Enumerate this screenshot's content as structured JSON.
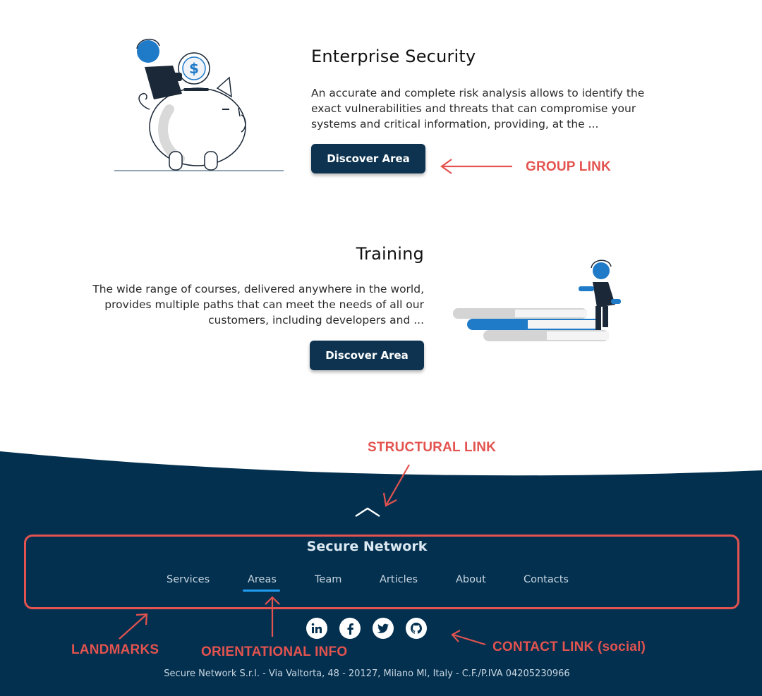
{
  "sections": [
    {
      "title": "Enterprise Security",
      "description": "An accurate and complete risk analysis allows to identify the exact vulnerabilities and threats that can compromise your systems and critical information, providing, at the ...",
      "button_label": "Discover Area",
      "illustration": "piggy-bank-illustration"
    },
    {
      "title": "Training",
      "description": "The wide range of courses, delivered anywhere in the world, provides multiple paths that can meet the needs of all our customers, including developers and ...",
      "button_label": "Discover Area",
      "illustration": "books-stairs-illustration"
    }
  ],
  "footer": {
    "brand": "Secure Network",
    "nav": [
      {
        "label": "Services",
        "active": false
      },
      {
        "label": "Areas",
        "active": true
      },
      {
        "label": "Team",
        "active": false
      },
      {
        "label": "Articles",
        "active": false
      },
      {
        "label": "About",
        "active": false
      },
      {
        "label": "Contacts",
        "active": false
      }
    ],
    "social_icons": [
      "linkedin-icon",
      "facebook-icon",
      "twitter-icon",
      "github-icon"
    ],
    "legal": "Secure Network S.r.l. - Via Valtorta, 48 - 20127, Milano MI, Italy - C.F./P.IVA 04205230966",
    "scroll_top_icon": "chevron-up-icon"
  },
  "annotations": {
    "group_link": "GROUP LINK",
    "structural_link": "STRUCTURAL LINK",
    "landmarks": "LANDMARKS",
    "orientational_info": "ORIENTATIONAL INFO",
    "contact_link": "CONTACT LINK (social)"
  },
  "colors": {
    "primary_dark": "#0d3350",
    "accent_blue": "#1f7ac8",
    "annotation_red": "#e3534f",
    "footer_bg": "#03304f"
  }
}
